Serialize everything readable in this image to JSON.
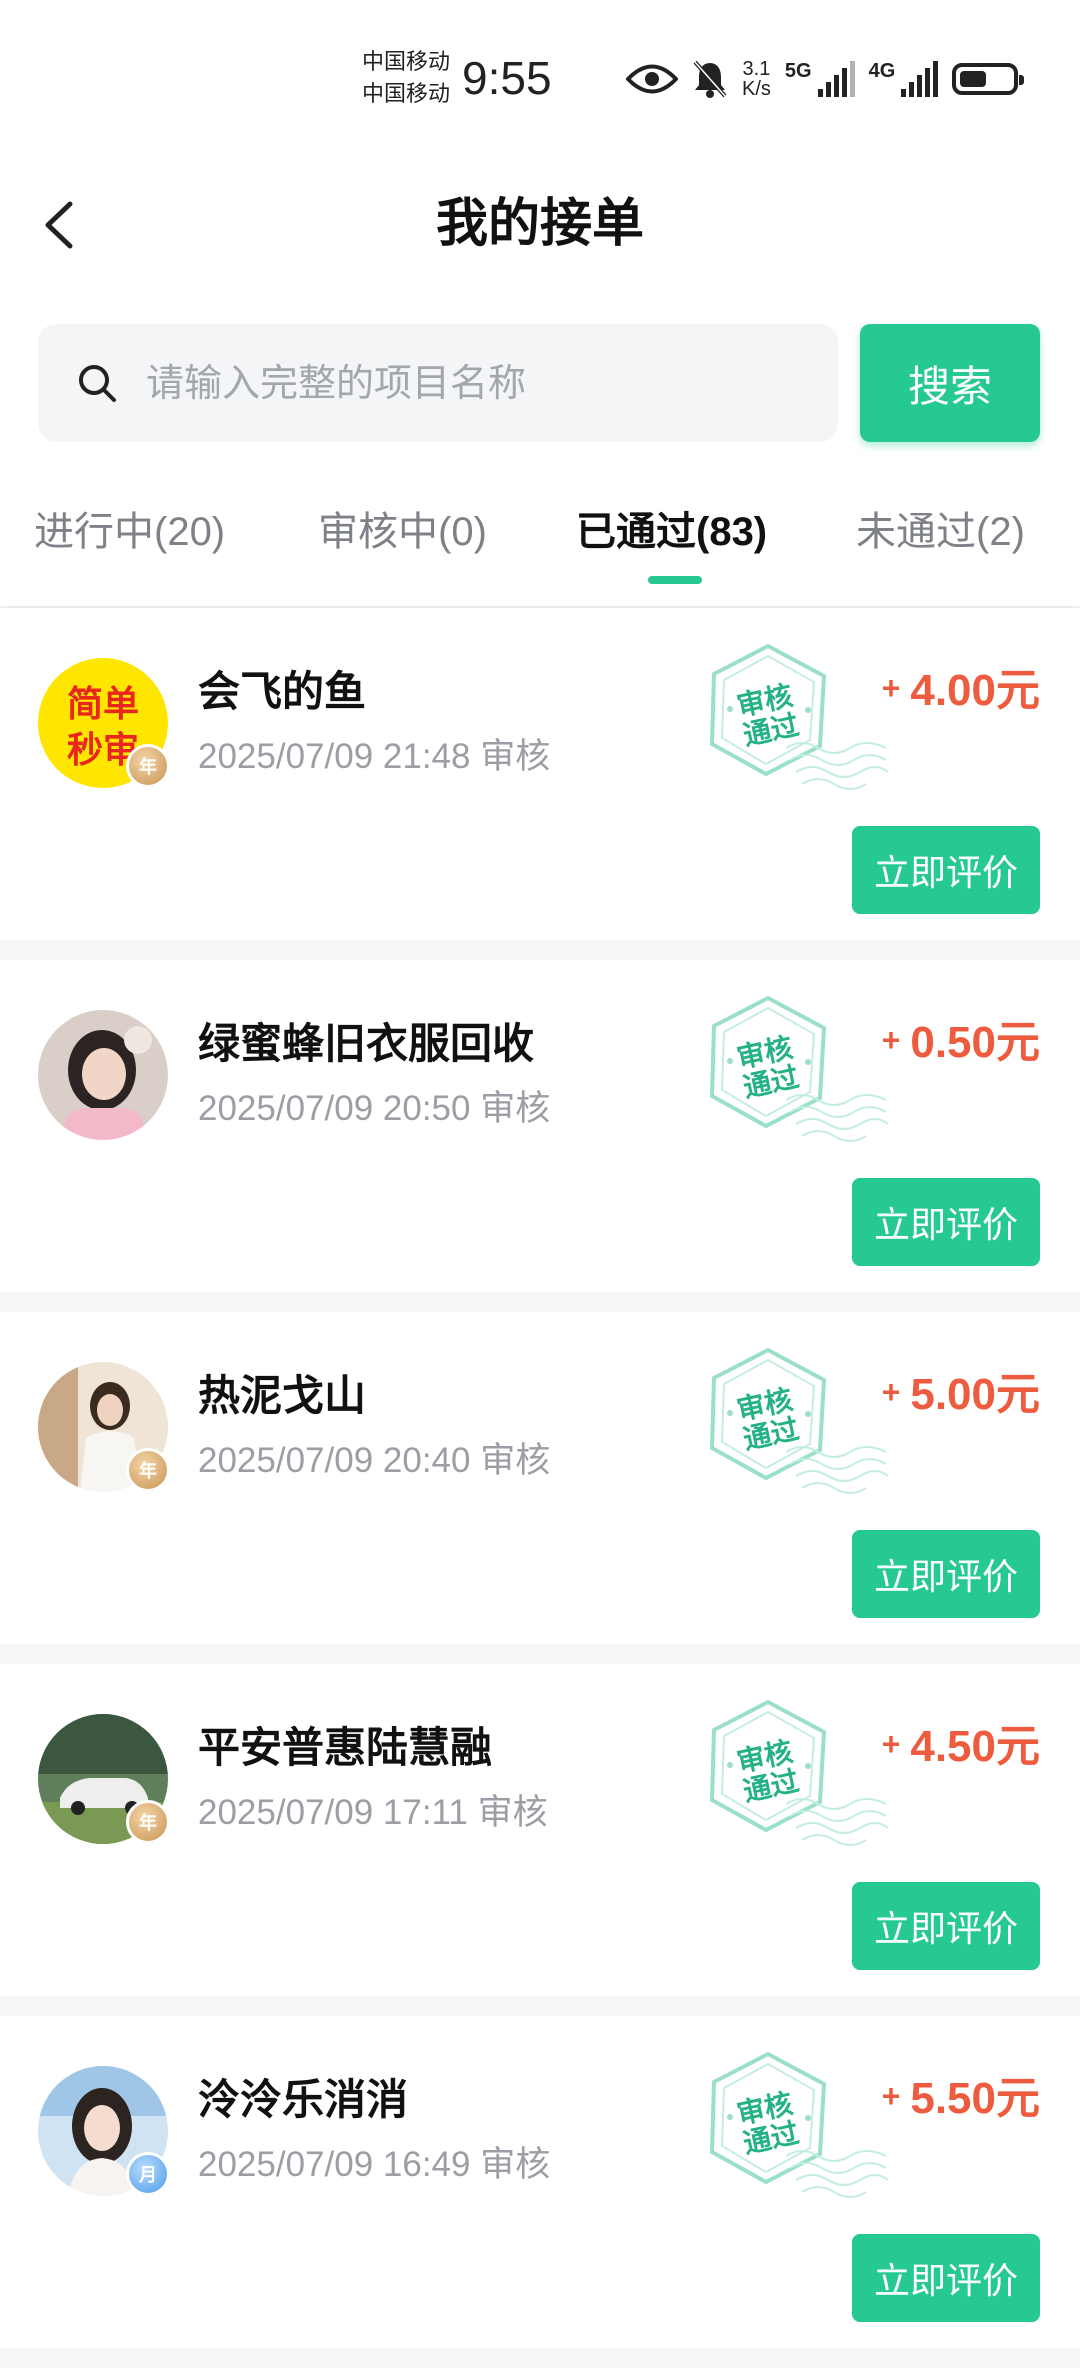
{
  "status_bar": {
    "carrier1": "中国移动",
    "carrier2": "中国移动",
    "time": "9:55",
    "speed_value": "3.1",
    "speed_unit": "K/s",
    "network1": "5G",
    "network2": "4G",
    "icons": [
      "eye-icon",
      "bell-off-icon",
      "signal-icon",
      "battery-icon"
    ]
  },
  "header": {
    "title": "我的接单",
    "back_icon": "chevron-left-icon"
  },
  "search": {
    "placeholder": "请输入完整的项目名称",
    "value": "",
    "button_label": "搜索",
    "icon": "search-icon"
  },
  "tabs": [
    {
      "label": "进行中(20)",
      "active": false
    },
    {
      "label": "审核中(0)",
      "active": false
    },
    {
      "label": "已通过(83)",
      "active": true
    },
    {
      "label": "未通过(2)",
      "active": false
    }
  ],
  "stamp_text_line1": "审核",
  "stamp_text_line2": "通过",
  "orders": [
    {
      "name": "会飞的鱼",
      "time": "2025/07/09 21:48 审核",
      "amount": "4.00元",
      "plus": "+",
      "action": "立即评价",
      "badge": "年",
      "avatar_text_line1": "简单",
      "avatar_text_line2": "秒审"
    },
    {
      "name": "绿蜜蜂旧衣服回收",
      "time": "2025/07/09 20:50 审核",
      "amount": "0.50元",
      "plus": "+",
      "action": "立即评价",
      "badge": ""
    },
    {
      "name": "热泥戈山",
      "time": "2025/07/09 20:40 审核",
      "amount": "5.00元",
      "plus": "+",
      "action": "立即评价",
      "badge": "年"
    },
    {
      "name": "平安普惠陆慧融",
      "time": "2025/07/09 17:11 审核",
      "amount": "4.50元",
      "plus": "+",
      "action": "立即评价",
      "badge": "年"
    },
    {
      "name": "泠泠乐消消",
      "time": "2025/07/09 16:49 审核",
      "amount": "5.50元",
      "plus": "+",
      "action": "立即评价",
      "badge": "月"
    }
  ],
  "colors": {
    "accent": "#27c992",
    "amount": "#ee5c3f",
    "stamp": "#27b187"
  }
}
